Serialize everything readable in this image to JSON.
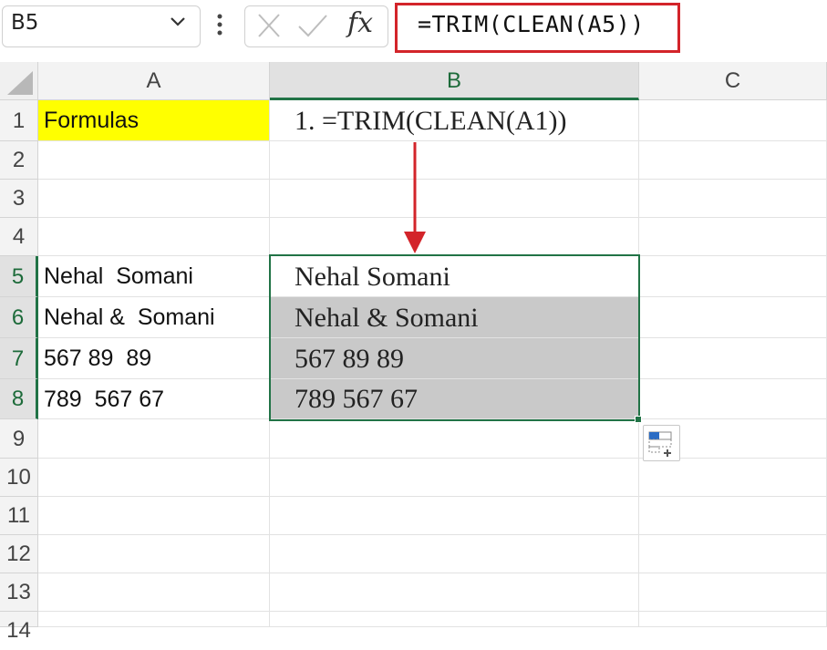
{
  "formula_bar": {
    "name_box": "B5",
    "fx_label": "fx",
    "formula": "=TRIM(CLEAN(A5))"
  },
  "columns": [
    "A",
    "B",
    "C"
  ],
  "rows": [
    "1",
    "2",
    "3",
    "4",
    "5",
    "6",
    "7",
    "8",
    "9",
    "10",
    "11",
    "12",
    "13",
    "14"
  ],
  "cells": {
    "A1": "Formulas",
    "B1": "1. =TRIM(CLEAN(A1))",
    "A5": "Nehal  Somani",
    "A6": "Nehal &  Somani",
    "A7": "567 89  89",
    "A8": "789  567 67",
    "B5": "Nehal Somani",
    "B6": "Nehal & Somani",
    "B7": "567 89 89",
    "B8": "789 567 67"
  },
  "colors": {
    "highlight_yellow": "#ffff00",
    "selection_green": "#217346",
    "annotation_red": "#d3242a",
    "selected_fill": "#c9c9c9"
  },
  "icons": {
    "name_box_dropdown": "chevron-down-icon",
    "more": "vertical-dots-icon",
    "cancel": "close-icon",
    "enter": "check-icon",
    "quick_analysis": "quick-analysis-icon"
  }
}
